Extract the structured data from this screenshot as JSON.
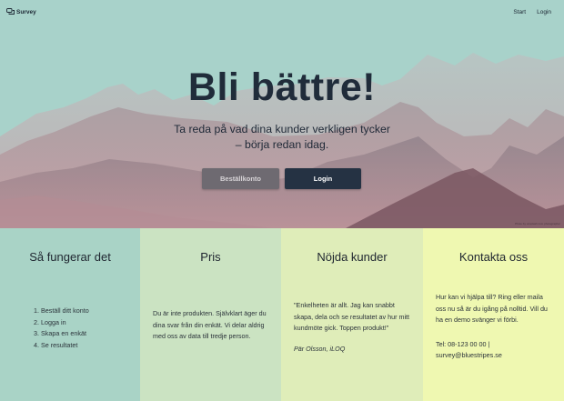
{
  "nav": {
    "brand": "Survey",
    "links": [
      "Start",
      "Login"
    ]
  },
  "hero": {
    "title": "Bli bättre!",
    "subtitle_line1": "Ta reda på vad dina kunder verkligen tycker",
    "subtitle_line2": "– börja redan idag.",
    "order_button": "Beställkonto",
    "login_button": "Login",
    "photo_credit": "Photo by unsplash.com photographer"
  },
  "sections": {
    "how": {
      "title": "Så fungerar det",
      "steps": [
        "1. Beställ ditt konto",
        "2. Logga in",
        "3. Skapa en enkät",
        "4. Se resultatet"
      ]
    },
    "price": {
      "title": "Pris",
      "text": "Du är inte produkten. Självklart äger du dina svar från din enkät. Vi delar aldrig med oss av data till tredje person."
    },
    "customers": {
      "title": "Nöjda kunder",
      "quote": "\"Enkelheten är allt. Jag kan snabbt skapa, dela och se resultatet av hur mitt kundmöte gick. Toppen produkt!\"",
      "author": "Pär Olsson, iLOQ"
    },
    "contact": {
      "title": "Kontakta oss",
      "text": "Hur kan vi hjälpa till? Ring eller maila oss nu så är du igång på nolltid. Vill du ha en demo svänger vi förbi.",
      "phone": "Tel: 08-123 00 00 |",
      "email": "survey@bluestripes.se"
    }
  },
  "colors": {
    "hero_bg": "#a8d2ca",
    "dark": "#202c3a",
    "col1": "#a9d3c6",
    "col2": "#cbe3c2",
    "col3": "#dfedb9",
    "col4": "#eff8b1"
  }
}
